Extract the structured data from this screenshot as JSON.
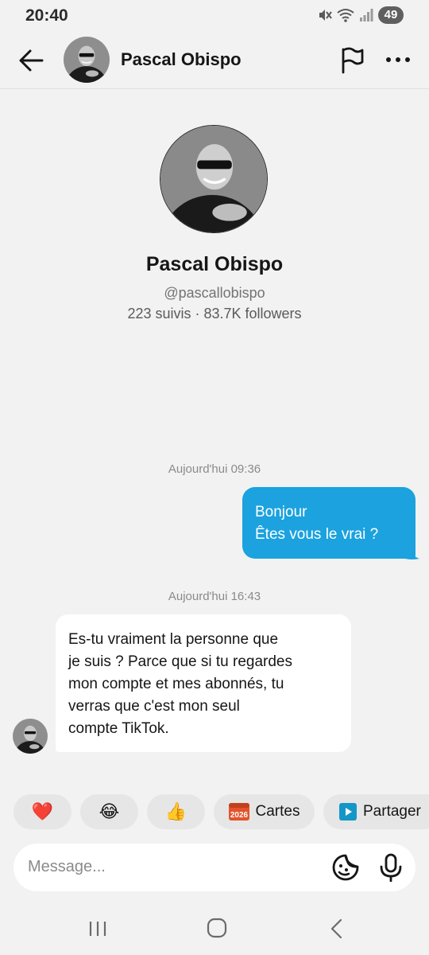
{
  "status_bar": {
    "time": "20:40",
    "battery": "49",
    "icons": [
      "mute-icon",
      "wifi-icon",
      "signal-icon",
      "battery-icon"
    ]
  },
  "header": {
    "name": "Pascal Obispo",
    "icons": [
      "back-arrow-icon",
      "flag-icon",
      "more-icon"
    ]
  },
  "profile": {
    "name": "Pascal Obispo",
    "handle": "@pascallobispo",
    "stats": "223 suivis · 83.7K followers"
  },
  "conversation": {
    "timestamp_1": "Aujourd'hui 09:36",
    "outgoing": [
      "Bonjour",
      "Êtes vous le vrai ?"
    ],
    "timestamp_2": "Aujourd'hui 16:43",
    "incoming": [
      "Es-tu vraiment la personne que",
      "je suis ? Parce que si tu regardes",
      "mon compte et mes abonnés, tu",
      "verras que c'est mon seul",
      "compte TikTok."
    ]
  },
  "quick_actions": {
    "heart": "❤️",
    "laugh": "😂",
    "thumbs": "👍",
    "cards_icon_text": "2026",
    "cards": "Cartes",
    "share": "Partager"
  },
  "composer": {
    "placeholder": "Message..."
  },
  "colors": {
    "background": "#f2f2f2",
    "outgoing_bubble": "#1ba2df",
    "incoming_bubble": "#ffffff",
    "chip": "#e6e6e6",
    "cards_icon": "#e2532c",
    "share_icon": "#1596c8"
  }
}
